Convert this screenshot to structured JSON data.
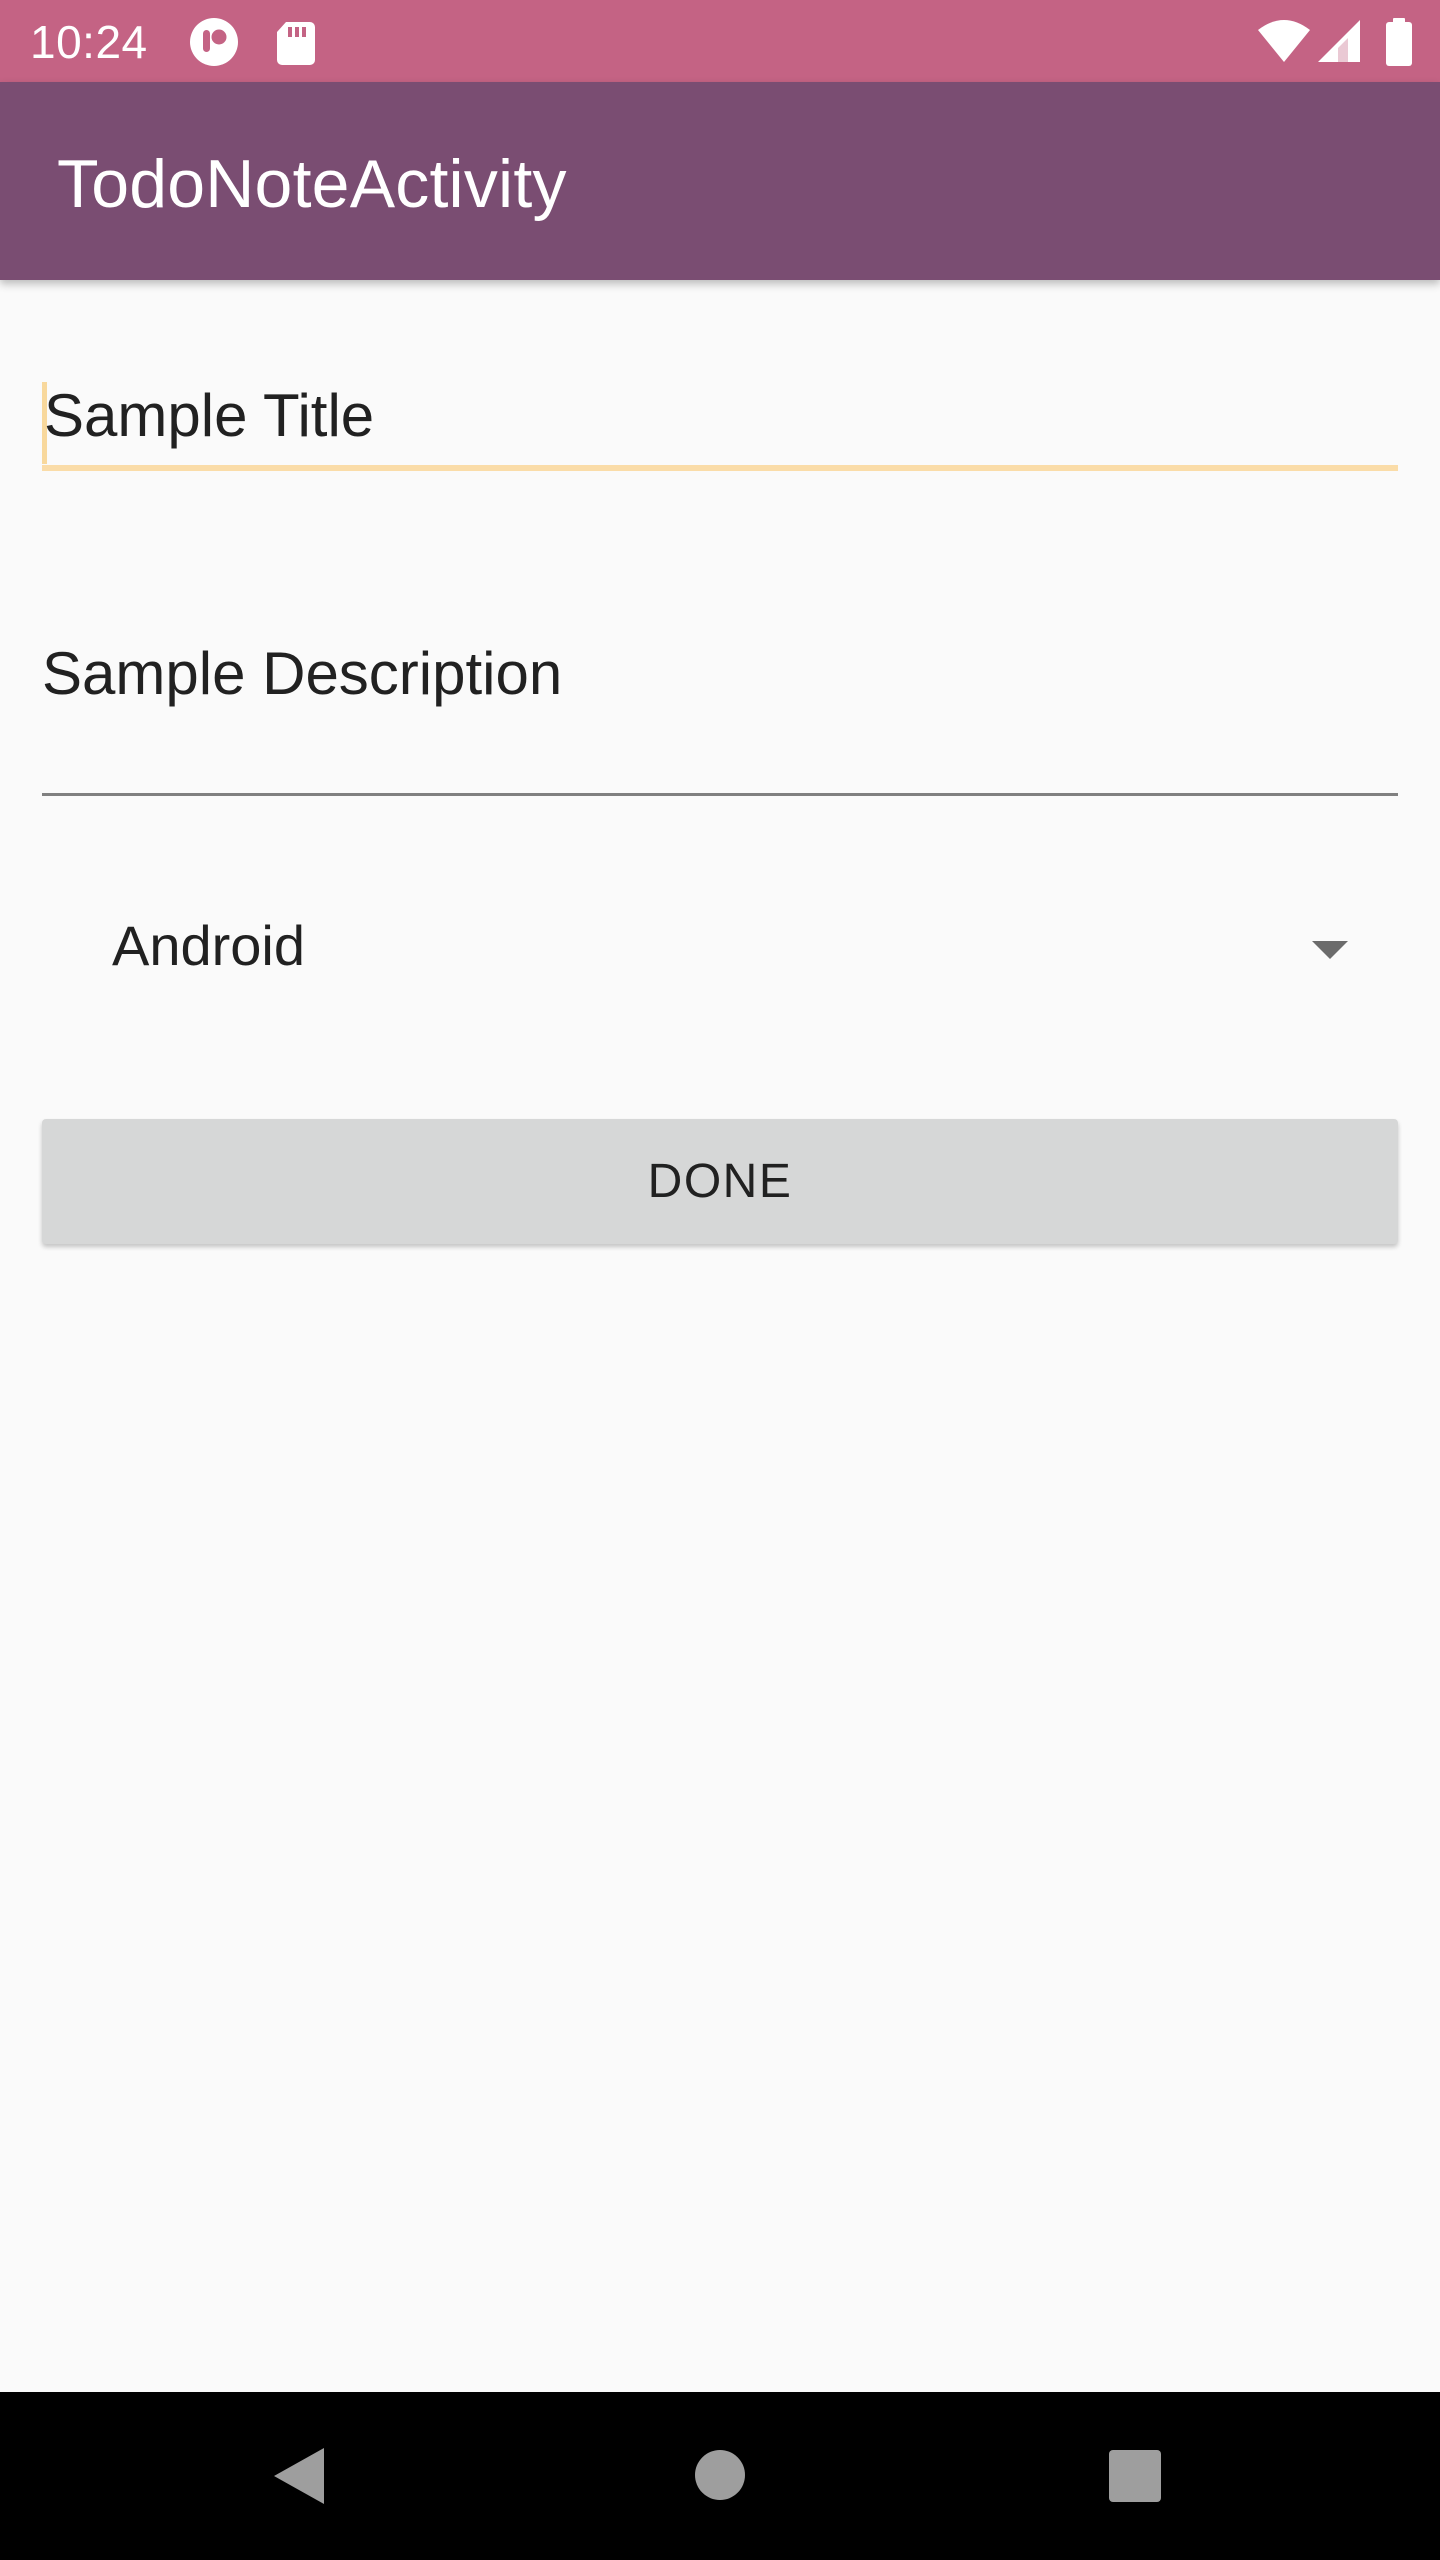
{
  "status_bar": {
    "time": "10:24",
    "icons": [
      "notification-app-icon",
      "sd-card-icon",
      "wifi-icon",
      "cell-signal-icon",
      "battery-icon"
    ]
  },
  "app_bar": {
    "title": "TodoNoteActivity"
  },
  "form": {
    "title_value": "Sample Title",
    "description_value": "Sample Description",
    "category_selected": "Android",
    "done_label": "DONE"
  },
  "colors": {
    "status_bar": "#c46384",
    "app_bar": "#7a4d72",
    "focus_accent": "#fadca8",
    "button_bg": "#d6d7d7",
    "background": "#fafafa"
  },
  "nav_bar": {
    "icons": [
      "back-icon",
      "home-icon",
      "recents-icon"
    ]
  }
}
